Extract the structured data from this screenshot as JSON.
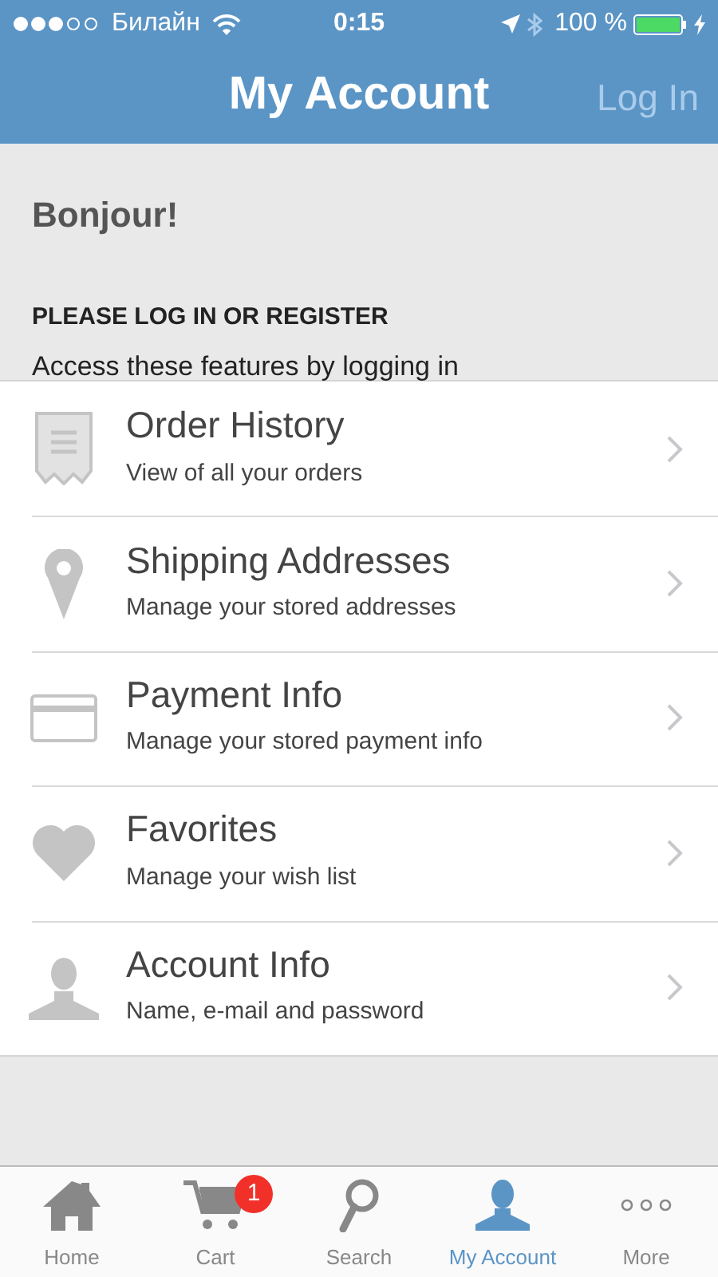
{
  "status_bar": {
    "carrier": "Билайн",
    "time": "0:15",
    "battery": "100 %"
  },
  "nav": {
    "title": "My Account",
    "action": "Log In"
  },
  "greeting": "Bonjour!",
  "prompt": {
    "heading": "PLEASE LOG IN OR REGISTER",
    "text": "Access these features by logging in"
  },
  "menu": [
    {
      "kind": "receipt",
      "title": "Order History",
      "subtitle": "View of all your orders"
    },
    {
      "kind": "pin",
      "title": "Shipping Addresses",
      "subtitle": "Manage your stored addresses"
    },
    {
      "kind": "card",
      "title": "Payment Info",
      "subtitle": "Manage your stored payment info"
    },
    {
      "kind": "heart",
      "title": "Favorites",
      "subtitle": "Manage your wish list"
    },
    {
      "kind": "person",
      "title": "Account Info",
      "subtitle": "Name, e-mail and password"
    }
  ],
  "tabs": [
    {
      "kind": "home",
      "label": "Home",
      "selected": false
    },
    {
      "kind": "cart",
      "label": "Cart",
      "selected": false,
      "badge": "1"
    },
    {
      "kind": "search",
      "label": "Search",
      "selected": false
    },
    {
      "kind": "person",
      "label": "My Account",
      "selected": true
    },
    {
      "kind": "more",
      "label": "More",
      "selected": false
    }
  ]
}
